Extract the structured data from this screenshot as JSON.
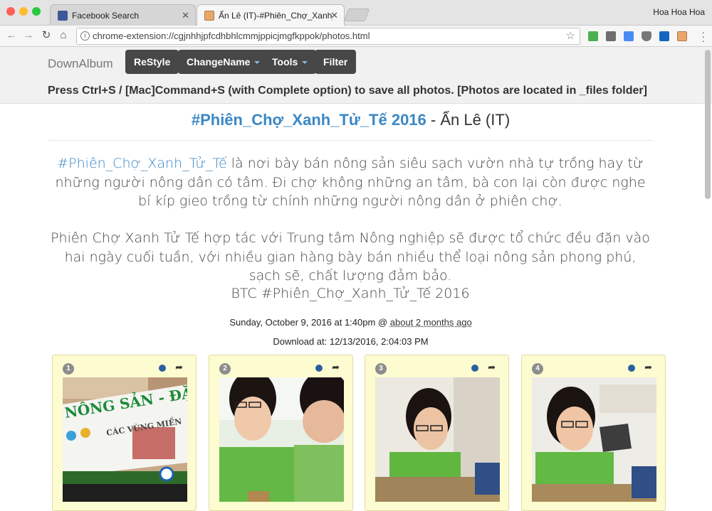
{
  "browser": {
    "tabs": [
      {
        "label": "Facebook Search",
        "active": false
      },
      {
        "label": "Ẩn Lê (IT)-#Phiên_Chợ_Xanh_T",
        "active": true
      }
    ],
    "profile_name": "Hoa Hoa Hoa",
    "url": "chrome-extension://cgjnhhjpfcdhbhlcmmjppicjmgfkppok/photos.html",
    "colors": {
      "close": "#ff5f57",
      "minimize": "#febc2e",
      "maximize": "#28c840"
    }
  },
  "navbar": {
    "brand": "DownAlbum",
    "buttons": [
      {
        "label": "ReStyle"
      },
      {
        "label": "ChangeName"
      },
      {
        "label": "Tools"
      },
      {
        "label": "Filter"
      }
    ],
    "save_note": "Press Ctrl+S / [Mac]Command+S (with Complete option) to save all photos. [Photos are located in _files folder]"
  },
  "album": {
    "title_hash": "#Phiên_Chợ_Xanh_Tử_Tế 2016",
    "title_rest": " - Ẩn Lê (IT)",
    "para1_hash": "#Phiên_Chợ_Xanh_Tử_Tế",
    "para1_rest": " là nơi bày bán nông sản siêu sạch vườn nhà tự trồng hay từ những người nông dân có tâm. Đi chợ không những an tâm, bà con lại còn được nghe bí kíp gieo trồng từ chính những người nông dân ở phiên chợ.",
    "para2": "Phiên Chợ Xanh Tử Tế hợp tác với Trung tâm Nông nghiệp sẽ được tổ chức đều đặn vào hai ngày cuối tuần, với nhiều gian hàng bày bán nhiều thể loại nông sản phong phú, sạch sẽ, chất lượng đảm bảo.",
    "para3": "BTC #Phiên_Chợ_Xanh_Tử_Tế 2016",
    "date_prefix": "Sunday, October 9, 2016 at 1:40pm @ ",
    "date_link": "about 2 months ago",
    "download": "Download at: 12/13/2016, 2:04:03 PM"
  },
  "photos": [
    {
      "index": "1"
    },
    {
      "index": "2"
    },
    {
      "index": "3"
    },
    {
      "index": "4"
    }
  ],
  "photo1_text": {
    "line1": "NÔNG SẢN - ĐẶC SẢN SẠ",
    "line2": "CÁC VÙNG MIỀN"
  }
}
